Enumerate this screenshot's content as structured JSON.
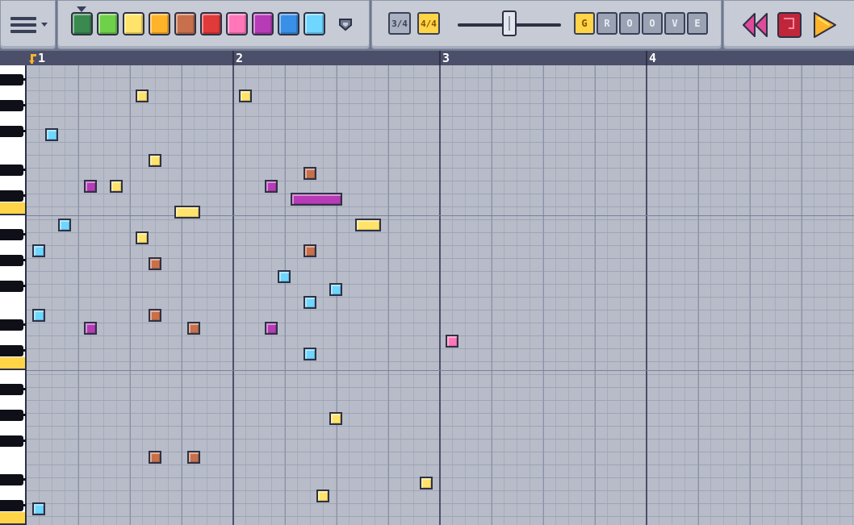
{
  "toolbar": {
    "menu": {
      "icon": "menu-icon"
    },
    "colors": [
      {
        "name": "dark-green",
        "hex": "#3a8a4f"
      },
      {
        "name": "green",
        "hex": "#6fd04a"
      },
      {
        "name": "yellow",
        "hex": "#ffe36a"
      },
      {
        "name": "orange",
        "hex": "#ffb32a"
      },
      {
        "name": "brown",
        "hex": "#c7704c"
      },
      {
        "name": "red",
        "hex": "#e03a3a"
      },
      {
        "name": "pink",
        "hex": "#ff77b8"
      },
      {
        "name": "purple",
        "hex": "#b73bb6"
      },
      {
        "name": "blue",
        "hex": "#3a8fe6"
      },
      {
        "name": "cyan",
        "hex": "#6fd6ff"
      }
    ],
    "selected_color": 0,
    "time_signature": {
      "option_3_4": "3/4",
      "option_4_4": "4/4",
      "selected": "4/4"
    },
    "tempo": {
      "level": 0.5
    },
    "groove": {
      "letters": [
        "G",
        "R",
        "O",
        "O",
        "V",
        "E"
      ],
      "active": 0
    },
    "transport": {
      "rewind_icon": "rewind-icon",
      "stop_icon": "stop-icon",
      "play_icon": "play-icon"
    }
  },
  "ruler": {
    "bars": [
      "1",
      "2",
      "3",
      "4"
    ]
  },
  "piano_roll": {
    "beats_per_bar": 4,
    "total_bars": 4,
    "rows": 36
  },
  "notes": [
    {
      "color": "yellow",
      "beat": 2.0,
      "row": 1,
      "len": 0.25
    },
    {
      "color": "yellow",
      "beat": 4.0,
      "row": 1,
      "len": 0.25
    },
    {
      "color": "cyan",
      "beat": 0.25,
      "row": 4,
      "len": 0.25
    },
    {
      "color": "yellow",
      "beat": 2.25,
      "row": 6,
      "len": 0.25
    },
    {
      "color": "brown",
      "beat": 5.25,
      "row": 7,
      "len": 0.25
    },
    {
      "color": "purple",
      "beat": 1.0,
      "row": 8,
      "len": 0.25
    },
    {
      "color": "yellow",
      "beat": 1.5,
      "row": 8,
      "len": 0.25
    },
    {
      "color": "purple",
      "beat": 4.5,
      "row": 8,
      "len": 0.25
    },
    {
      "color": "purple",
      "beat": 5.0,
      "row": 9,
      "len": 1.0
    },
    {
      "color": "yellow",
      "beat": 2.75,
      "row": 10,
      "len": 0.5
    },
    {
      "color": "cyan",
      "beat": 0.5,
      "row": 11,
      "len": 0.25
    },
    {
      "color": "yellow",
      "beat": 6.25,
      "row": 11,
      "len": 0.5
    },
    {
      "color": "yellow",
      "beat": 2.0,
      "row": 12,
      "len": 0.25
    },
    {
      "color": "cyan",
      "beat": 0.0,
      "row": 13,
      "len": 0.25
    },
    {
      "color": "brown",
      "beat": 5.25,
      "row": 13,
      "len": 0.25
    },
    {
      "color": "brown",
      "beat": 2.25,
      "row": 14,
      "len": 0.25
    },
    {
      "color": "cyan",
      "beat": 4.75,
      "row": 15,
      "len": 0.25
    },
    {
      "color": "cyan",
      "beat": 5.75,
      "row": 16,
      "len": 0.25
    },
    {
      "color": "cyan",
      "beat": 5.25,
      "row": 17,
      "len": 0.25
    },
    {
      "color": "cyan",
      "beat": 0.0,
      "row": 18,
      "len": 0.25
    },
    {
      "color": "brown",
      "beat": 2.25,
      "row": 18,
      "len": 0.25
    },
    {
      "color": "purple",
      "beat": 1.0,
      "row": 19,
      "len": 0.25
    },
    {
      "color": "brown",
      "beat": 3.0,
      "row": 19,
      "len": 0.25
    },
    {
      "color": "purple",
      "beat": 4.5,
      "row": 19,
      "len": 0.25
    },
    {
      "color": "pink",
      "beat": 8.0,
      "row": 20,
      "len": 0.25
    },
    {
      "color": "cyan",
      "beat": 5.25,
      "row": 21,
      "len": 0.25
    },
    {
      "color": "yellow",
      "beat": 5.75,
      "row": 26,
      "len": 0.25
    },
    {
      "color": "brown",
      "beat": 2.25,
      "row": 29,
      "len": 0.25
    },
    {
      "color": "brown",
      "beat": 3.0,
      "row": 29,
      "len": 0.25
    },
    {
      "color": "yellow",
      "beat": 7.5,
      "row": 31,
      "len": 0.25
    },
    {
      "color": "yellow",
      "beat": 5.5,
      "row": 32,
      "len": 0.25
    },
    {
      "color": "cyan",
      "beat": 0.0,
      "row": 33,
      "len": 0.25
    }
  ]
}
